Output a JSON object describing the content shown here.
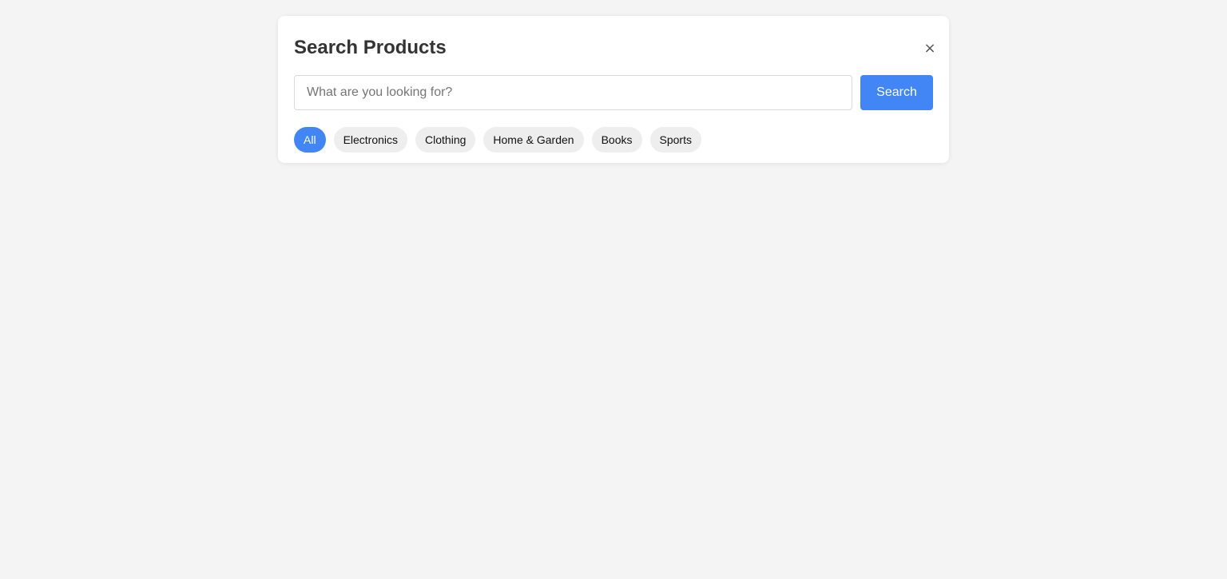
{
  "panel": {
    "title": "Search Products",
    "close_glyph": "×",
    "close_icon": "close-icon"
  },
  "search": {
    "placeholder": "What are you looking for?",
    "value": "",
    "button_label": "Search"
  },
  "categories": {
    "items": [
      {
        "label": "All",
        "active": true
      },
      {
        "label": "Electronics",
        "active": false
      },
      {
        "label": "Clothing",
        "active": false
      },
      {
        "label": "Home & Garden",
        "active": false
      },
      {
        "label": "Books",
        "active": false
      },
      {
        "label": "Sports",
        "active": false
      }
    ]
  },
  "colors": {
    "accent": "#4285f4",
    "page_background": "#f4f4f4",
    "chip_background": "#eeeeee"
  }
}
